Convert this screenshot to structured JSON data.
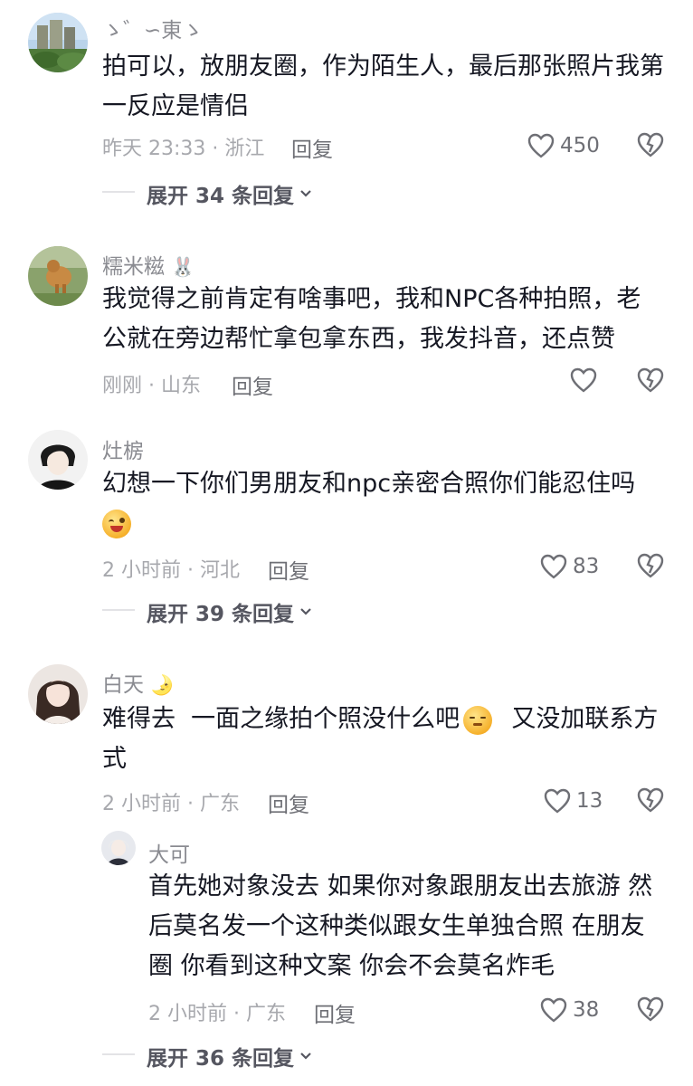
{
  "comments": [
    {
      "name": "ゝ゛∽東ゝ",
      "text": "拍可以，放朋友圈，作为陌生人，最后那张照片我第一反应是情侣",
      "time": "昨天 23:33 · 浙江",
      "reply": "回复",
      "likes": "450",
      "expand": "展开 34 条回复"
    },
    {
      "name": "糯米糍",
      "name_emoji": "🐰",
      "text": "我觉得之前肯定有啥事吧，我和NPC各种拍照，老公就在旁边帮忙拿包拿东西，我发抖音，还点赞",
      "time": "刚刚 · 山东",
      "reply": "回复"
    },
    {
      "name": "灶椖",
      "text": "幻想一下你们男朋友和npc亲密合照你们能忍住吗",
      "emoji": "😜",
      "time": "2 小时前 · 河北",
      "reply": "回复",
      "likes": "83",
      "expand": "展开 39 条回复"
    },
    {
      "name": "白天",
      "name_emoji": "🌛",
      "text_a": "难得去  一面之缘拍个照没什么吧",
      "emoji": "😑",
      "text_b": "  又没加联系方式",
      "time": "2 小时前 · 广东",
      "reply": "回复",
      "likes": "13"
    }
  ],
  "sub_reply": {
    "name": "大可",
    "text": "首先她对象没去  如果你对象跟朋友出去旅游 然后莫名发一个这种类似跟女生单独合照 在朋友圈 你看到这种文案 你会不会莫名炸毛",
    "time": "2 小时前 · 广东",
    "reply": "回复",
    "likes": "38"
  },
  "bottom_expand": "展开 36 条回复",
  "icons": {
    "like": "heart-outline-icon",
    "dislike": "broken-heart-icon",
    "expand": "chevron-down-icon"
  },
  "colors": {
    "text": "#161823",
    "meta": "#a7a8ad",
    "name": "#8a8b91"
  }
}
